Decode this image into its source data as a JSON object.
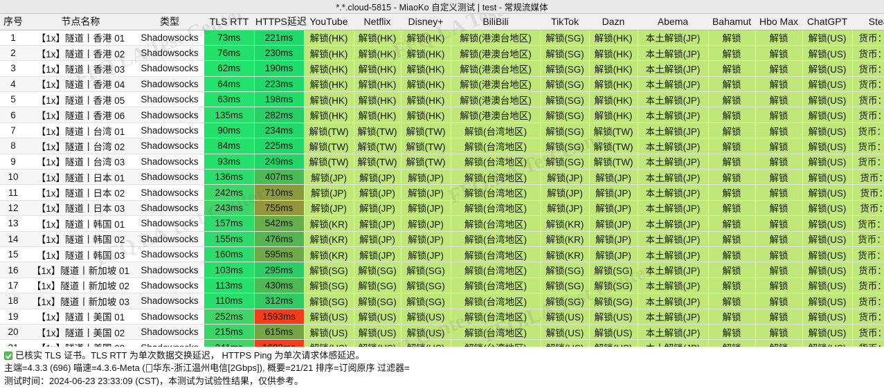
{
  "window": {
    "title": "*.*.cloud-5815 - MiaoKo 自定义测试 | test - 常规流媒体"
  },
  "watermark": {
    "text": "FFQ.LA Test Center"
  },
  "table": {
    "columns": [
      {
        "key": "idx",
        "label": "序号"
      },
      {
        "key": "name",
        "label": "节点名称"
      },
      {
        "key": "type",
        "label": "类型"
      },
      {
        "key": "tls",
        "label": "TLS RTT"
      },
      {
        "key": "https",
        "label": "HTTPS延迟"
      },
      {
        "key": "yt",
        "label": "YouTube"
      },
      {
        "key": "nf",
        "label": "Netflix"
      },
      {
        "key": "dp",
        "label": "Disney+"
      },
      {
        "key": "bili",
        "label": "BiliBili"
      },
      {
        "key": "tt",
        "label": "TikTok"
      },
      {
        "key": "dazn",
        "label": "Dazn"
      },
      {
        "key": "abema",
        "label": "Abema"
      },
      {
        "key": "baha",
        "label": "Bahamut"
      },
      {
        "key": "hbo",
        "label": "Hbo Max"
      },
      {
        "key": "gpt",
        "label": "ChatGPT"
      },
      {
        "key": "steam",
        "label": "Steam"
      }
    ],
    "rows": [
      {
        "idx": "1",
        "name": "【1x】隧道丨香港 01",
        "type": "Shadowsocks",
        "tls": "73ms",
        "tls_bg": "#22e06a",
        "https": "221ms",
        "https_bg": "#1fd96a",
        "yt": "解锁(HK)",
        "nf": "解锁(HK)",
        "dp": "解锁(HK)",
        "bili": "解锁(港澳台地区)",
        "tt": "解锁(SG)",
        "dazn": "解锁(HK)",
        "abema": "本土解锁(JP)",
        "baha": "解锁",
        "hbo": "解锁",
        "gpt": "解锁(US)",
        "steam": "货币：HKD"
      },
      {
        "idx": "2",
        "name": "【1x】隧道丨香港 02",
        "type": "Shadowsocks",
        "tls": "76ms",
        "tls_bg": "#22e06a",
        "https": "230ms",
        "https_bg": "#20d869",
        "yt": "解锁(HK)",
        "nf": "解锁(HK)",
        "dp": "解锁(HK)",
        "bili": "解锁(港澳台地区)",
        "tt": "解锁(SG)",
        "dazn": "解锁(HK)",
        "abema": "本土解锁(JP)",
        "baha": "解锁",
        "hbo": "解锁",
        "gpt": "解锁(US)",
        "steam": "货币：HKD"
      },
      {
        "idx": "3",
        "name": "【1x】隧道丨香港 03",
        "type": "Shadowsocks",
        "tls": "62ms",
        "tls_bg": "#22e36b",
        "https": "190ms",
        "https_bg": "#1fdd6c",
        "yt": "解锁(HK)",
        "nf": "解锁(HK)",
        "dp": "解锁(HK)",
        "bili": "解锁(港澳台地区)",
        "tt": "解锁(SG)",
        "dazn": "解锁(HK)",
        "abema": "本土解锁(JP)",
        "baha": "解锁",
        "hbo": "解锁",
        "gpt": "解锁(US)",
        "steam": "货币：HKD"
      },
      {
        "idx": "4",
        "name": "【1x】隧道丨香港 04",
        "type": "Shadowsocks",
        "tls": "64ms",
        "tls_bg": "#22e36b",
        "https": "223ms",
        "https_bg": "#1fd96a",
        "yt": "解锁(HK)",
        "nf": "解锁(HK)",
        "dp": "解锁(HK)",
        "bili": "解锁(港澳台地区)",
        "tt": "解锁(SG)",
        "dazn": "解锁(HK)",
        "abema": "本土解锁(JP)",
        "baha": "解锁",
        "hbo": "解锁",
        "gpt": "解锁(US)",
        "steam": "货币：HKD"
      },
      {
        "idx": "5",
        "name": "【1x】隧道丨香港 05",
        "type": "Shadowsocks",
        "tls": "63ms",
        "tls_bg": "#22e36b",
        "https": "198ms",
        "https_bg": "#1fdc6b",
        "yt": "解锁(HK)",
        "nf": "解锁(HK)",
        "dp": "解锁(HK)",
        "bili": "解锁(港澳台地区)",
        "tt": "解锁(SG)",
        "dazn": "解锁(HK)",
        "abema": "本土解锁(JP)",
        "baha": "解锁",
        "hbo": "解锁",
        "gpt": "解锁(US)",
        "steam": "货币：HKD"
      },
      {
        "idx": "6",
        "name": "【1x】隧道丨香港 06",
        "type": "Shadowsocks",
        "tls": "135ms",
        "tls_bg": "#2ade6d",
        "https": "282ms",
        "https_bg": "#2ace68",
        "yt": "解锁(HK)",
        "nf": "解锁(HK)",
        "dp": "解锁(HK)",
        "bili": "解锁(港澳台地区)",
        "tt": "解锁(SG)",
        "dazn": "解锁(HK)",
        "abema": "本土解锁(JP)",
        "baha": "解锁",
        "hbo": "解锁",
        "gpt": "解锁(US)",
        "steam": "货币：HKD"
      },
      {
        "idx": "7",
        "name": "【1x】隧道丨台湾 01",
        "type": "Shadowsocks",
        "tls": "90ms",
        "tls_bg": "#24e16b",
        "https": "234ms",
        "https_bg": "#21d869",
        "yt": "解锁(TW)",
        "nf": "解锁(TW)",
        "dp": "解锁(TW)",
        "bili": "解锁(台湾地区)",
        "tt": "解锁(SG)",
        "dazn": "解锁(TW)",
        "abema": "本土解锁(JP)",
        "baha": "解锁",
        "hbo": "解锁",
        "gpt": "解锁(US)",
        "steam": "货币：TWD"
      },
      {
        "idx": "8",
        "name": "【1x】隧道丨台湾 02",
        "type": "Shadowsocks",
        "tls": "84ms",
        "tls_bg": "#24e16b",
        "https": "225ms",
        "https_bg": "#21d969",
        "yt": "解锁(TW)",
        "nf": "解锁(TW)",
        "dp": "解锁(TW)",
        "bili": "解锁(台湾地区)",
        "tt": "解锁(SG)",
        "dazn": "解锁(TW)",
        "abema": "本土解锁(JP)",
        "baha": "解锁",
        "hbo": "解锁",
        "gpt": "解锁(US)",
        "steam": "货币：TWD"
      },
      {
        "idx": "9",
        "name": "【1x】隧道丨台湾 03",
        "type": "Shadowsocks",
        "tls": "93ms",
        "tls_bg": "#24e16b",
        "https": "249ms",
        "https_bg": "#23d568",
        "yt": "解锁(TW)",
        "nf": "解锁(TW)",
        "dp": "解锁(TW)",
        "bili": "解锁(台湾地区)",
        "tt": "解锁(SG)",
        "dazn": "解锁(TW)",
        "abema": "本土解锁(JP)",
        "baha": "解锁",
        "hbo": "解锁",
        "gpt": "解锁(US)",
        "steam": "货币：TWD"
      },
      {
        "idx": "10",
        "name": "【1x】隧道丨日本 01",
        "type": "Shadowsocks",
        "tls": "136ms",
        "tls_bg": "#2ade6d",
        "https": "407ms",
        "https_bg": "#4bbb55",
        "yt": "解锁(JP)",
        "nf": "解锁(JP)",
        "dp": "解锁(JP)",
        "bili": "解锁(台湾地区)",
        "tt": "解锁(JP)",
        "dazn": "解锁(JP)",
        "abema": "本土解锁(JP)",
        "baha": "解锁",
        "hbo": "解锁",
        "gpt": "解锁(US)",
        "steam": "货币：JPY"
      },
      {
        "idx": "11",
        "name": "【1x】隧道丨日本 02",
        "type": "Shadowsocks",
        "tls": "242ms",
        "tls_bg": "#3fd569",
        "https": "710ms",
        "https_bg": "#8a9a3d",
        "yt": "解锁(JP)",
        "nf": "解锁(JP)",
        "dp": "解锁(JP)",
        "bili": "解锁(台湾地区)",
        "tt": "解锁(JP)",
        "dazn": "解锁(JP)",
        "abema": "本土解锁(JP)",
        "baha": "解锁",
        "hbo": "解锁",
        "gpt": "解锁(US)",
        "steam": "货币：JPY"
      },
      {
        "idx": "12",
        "name": "【1x】隧道丨日本 03",
        "type": "Shadowsocks",
        "tls": "243ms",
        "tls_bg": "#3fd569",
        "https": "755ms",
        "https_bg": "#93963b",
        "yt": "解锁(JP)",
        "nf": "解锁(JP)",
        "dp": "解锁(JP)",
        "bili": "解锁(台湾地区)",
        "tt": "解锁(JP)",
        "dazn": "解锁(JP)",
        "abema": "本土解锁(JP)",
        "baha": "解锁",
        "hbo": "解锁",
        "gpt": "解锁(US)",
        "steam": "货币：JPY"
      },
      {
        "idx": "13",
        "name": "【1x】隧道丨韩国 01",
        "type": "Shadowsocks",
        "tls": "157ms",
        "tls_bg": "#2edb6c",
        "https": "542ms",
        "https_bg": "#65ae4a",
        "yt": "解锁(KR)",
        "nf": "解锁(JP)",
        "dp": "解锁(JP)",
        "bili": "解锁(台湾地区)",
        "tt": "解锁(KR)",
        "dazn": "解锁(JP)",
        "abema": "本土解锁(JP)",
        "baha": "解锁",
        "hbo": "解锁",
        "gpt": "解锁(US)",
        "steam": "货币：KRW"
      },
      {
        "idx": "14",
        "name": "【1x】隧道丨韩国 02",
        "type": "Shadowsocks",
        "tls": "155ms",
        "tls_bg": "#2edb6c",
        "https": "476ms",
        "https_bg": "#56b550",
        "yt": "解锁(KR)",
        "nf": "解锁(JP)",
        "dp": "解锁(JP)",
        "bili": "解锁(台湾地区)",
        "tt": "解锁(KR)",
        "dazn": "解锁(JP)",
        "abema": "本土解锁(JP)",
        "baha": "解锁",
        "hbo": "解锁",
        "gpt": "解锁(US)",
        "steam": "货币：KRW"
      },
      {
        "idx": "15",
        "name": "【1x】隧道丨韩国 03",
        "type": "Shadowsocks",
        "tls": "160ms",
        "tls_bg": "#2edb6c",
        "https": "595ms",
        "https_bg": "#70a946",
        "yt": "解锁(KR)",
        "nf": "解锁(JP)",
        "dp": "解锁(JP)",
        "bili": "解锁(台湾地区)",
        "tt": "解锁(KR)",
        "dazn": "解锁(JP)",
        "abema": "本土解锁(JP)",
        "baha": "解锁",
        "hbo": "解锁",
        "gpt": "解锁(US)",
        "steam": "货币：KRW"
      },
      {
        "idx": "16",
        "name": "【1x】隧道丨新加坡 01",
        "type": "Shadowsocks",
        "tls": "103ms",
        "tls_bg": "#26e06b",
        "https": "295ms",
        "https_bg": "#2ecc66",
        "yt": "解锁(SG)",
        "nf": "解锁(SG)",
        "dp": "解锁(SG)",
        "bili": "解锁(台湾地区)",
        "tt": "解锁(SG)",
        "dazn": "解锁(SG)",
        "abema": "本土解锁(JP)",
        "baha": "解锁",
        "hbo": "解锁",
        "gpt": "解锁(US)",
        "steam": "货币：SGD"
      },
      {
        "idx": "17",
        "name": "【1x】隧道丨新加坡 02",
        "type": "Shadowsocks",
        "tls": "113ms",
        "tls_bg": "#27df6b",
        "https": "430ms",
        "https_bg": "#4eb953",
        "yt": "解锁(SG)",
        "nf": "解锁(SG)",
        "dp": "解锁(SG)",
        "bili": "解锁(台湾地区)",
        "tt": "解锁(SG)",
        "dazn": "解锁(SG)",
        "abema": "本土解锁(JP)",
        "baha": "解锁",
        "hbo": "解锁",
        "gpt": "解锁(US)",
        "steam": "货币：SGD"
      },
      {
        "idx": "18",
        "name": "【1x】隧道丨新加坡 03",
        "type": "Shadowsocks",
        "tls": "110ms",
        "tls_bg": "#27df6b",
        "https": "312ms",
        "https_bg": "#33c963",
        "yt": "解锁(SG)",
        "nf": "解锁(SG)",
        "dp": "解锁(SG)",
        "bili": "解锁(台湾地区)",
        "tt": "解锁(SG)",
        "dazn": "解锁(SG)",
        "abema": "本土解锁(JP)",
        "baha": "解锁",
        "hbo": "解锁",
        "gpt": "解锁(US)",
        "steam": "货币：SGD"
      },
      {
        "idx": "19",
        "name": "【1x】隧道丨美国 01",
        "type": "Shadowsocks",
        "tls": "252ms",
        "tls_bg": "#41d468",
        "https": "1593ms",
        "https_bg": "#f63d19",
        "yt": "解锁(US)",
        "nf": "解锁(US)",
        "dp": "解锁(US)",
        "bili": "解锁(台湾地区)",
        "tt": "解锁(US)",
        "dazn": "解锁(US)",
        "abema": "本土解锁(JP)",
        "baha": "解锁",
        "hbo": "解锁",
        "gpt": "解锁(US)",
        "steam": "货币：USD"
      },
      {
        "idx": "20",
        "name": "【1x】隧道丨美国 02",
        "type": "Shadowsocks",
        "tls": "215ms",
        "tls_bg": "#39d76a",
        "https": "615ms",
        "https_bg": "#76a644",
        "yt": "解锁(US)",
        "nf": "解锁(US)",
        "dp": "解锁(US)",
        "bili": "解锁(台湾地区)",
        "tt": "解锁(US)",
        "dazn": "解锁(US)",
        "abema": "本土解锁(JP)",
        "baha": "解锁",
        "hbo": "解锁",
        "gpt": "解锁(US)",
        "steam": "货币：USD"
      },
      {
        "idx": "21",
        "name": "【1x】隧道丨美国 03",
        "type": "Shadowsocks",
        "tls": "241ms",
        "tls_bg": "#3fd569",
        "https": "1693ms",
        "https_bg": "#f63d19",
        "yt": "解锁(US)",
        "nf": "解锁(US)",
        "dp": "解锁(US)",
        "bili": "解锁(台湾地区)",
        "tt": "解锁(US)",
        "dazn": "解锁(US)",
        "abema": "本土解锁(JP)",
        "baha": "解锁",
        "hbo": "解锁",
        "gpt": "解锁(US)",
        "steam": "货币：USD"
      }
    ]
  },
  "footer": {
    "line1": "已核实 TLS 证书。TLS RTT 为单次数据交换延迟， HTTPS Ping 为单次请求体感延迟。",
    "line2_a": "主端=4.3.3 (696) 喵速=4.3.6-Meta (",
    "line2_b": "华东-浙江温州电信[2Gbps]), 概要=21/21 排序=订阅原序 过滤器=",
    "line3": "测试时间：2024-06-23 23:33:09 (CST)，本测试为试验性结果，仅供参考。"
  },
  "colors": {
    "media_bg": "#c0e878",
    "fast_green": "#22e06a",
    "slow_red": "#f63d19",
    "header_bg": "#f0f0f0"
  }
}
